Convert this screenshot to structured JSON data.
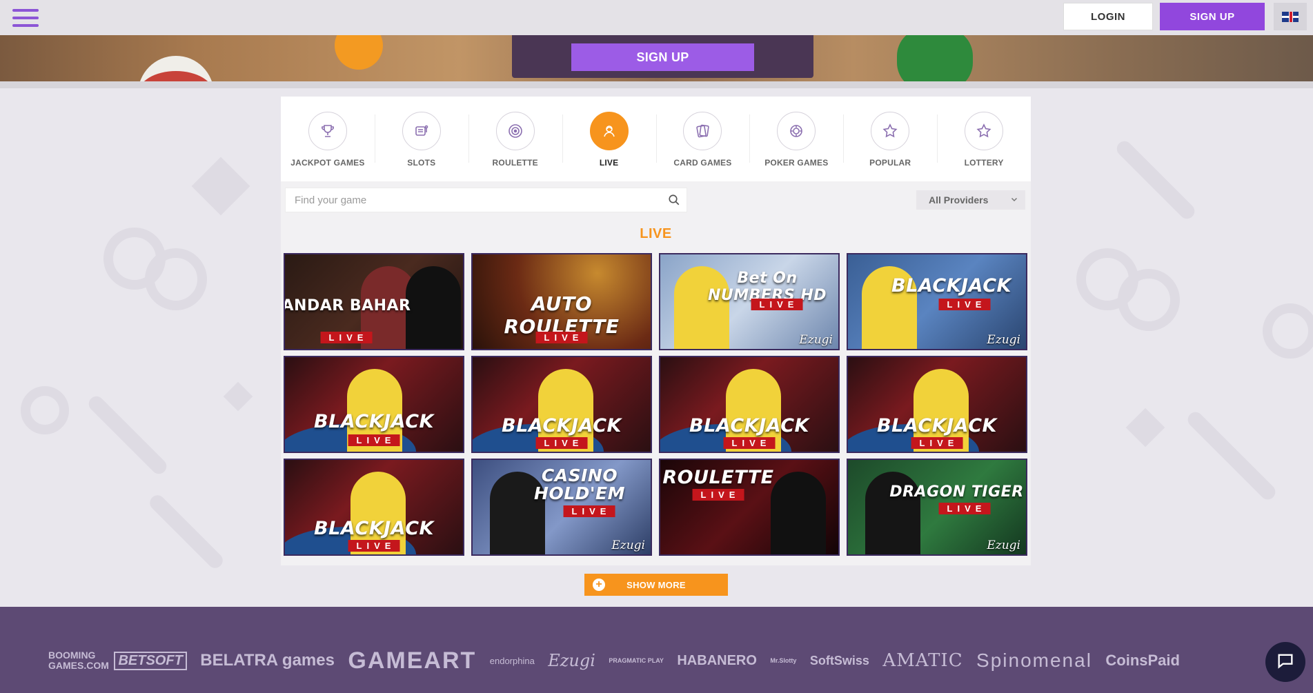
{
  "header": {
    "login_label": "LOGIN",
    "signup_label": "SIGN UP",
    "language_icon": "uk-flag-icon"
  },
  "banner": {
    "signup_label": "SIGN UP"
  },
  "categories": [
    {
      "label": "JACKPOT GAMES",
      "icon": "trophy-icon",
      "active": false
    },
    {
      "label": "SLOTS",
      "icon": "slot-machine-icon",
      "active": false
    },
    {
      "label": "ROULETTE",
      "icon": "roulette-icon",
      "active": false
    },
    {
      "label": "LIVE",
      "icon": "live-dealer-icon",
      "active": true
    },
    {
      "label": "CARD GAMES",
      "icon": "cards-icon",
      "active": false
    },
    {
      "label": "POKER GAMES",
      "icon": "poker-chip-icon",
      "active": false
    },
    {
      "label": "POPULAR",
      "icon": "star-icon",
      "active": false
    },
    {
      "label": "LOTTERY",
      "icon": "star-icon",
      "active": false
    }
  ],
  "search": {
    "placeholder": "Find your game"
  },
  "providers_filter": {
    "selected": "All Providers"
  },
  "section": {
    "title": "LIVE"
  },
  "games": [
    {
      "title": "ANDAR BAHAR",
      "badge": "LIVE",
      "brand": ""
    },
    {
      "title": "AUTO ROULETTE",
      "badge": "LIVE",
      "brand": ""
    },
    {
      "title": "Bet On NUMBERS HD",
      "badge": "LIVE",
      "brand": "Ezugi"
    },
    {
      "title": "BLACKJACK",
      "badge": "LIVE",
      "brand": "Ezugi"
    },
    {
      "title": "BLACKJACK",
      "badge": "LIVE",
      "brand": ""
    },
    {
      "title": "BLACKJACK",
      "badge": "LIVE",
      "brand": ""
    },
    {
      "title": "BLACKJACK",
      "badge": "LIVE",
      "brand": ""
    },
    {
      "title": "BLACKJACK",
      "badge": "LIVE",
      "brand": ""
    },
    {
      "title": "BLACKJACK",
      "badge": "LIVE",
      "brand": ""
    },
    {
      "title": "CASINO HOLD'EM",
      "badge": "LIVE",
      "brand": "Ezugi"
    },
    {
      "title": "ROULETTE",
      "badge": "LIVE",
      "brand": ""
    },
    {
      "title": "DRAGON TIGER",
      "badge": "LIVE",
      "brand": "Ezugi"
    }
  ],
  "show_more": {
    "label": "SHOW MORE"
  },
  "footer": {
    "provider_logos": [
      "BOOMING GAMES.COM",
      "BETSOFT",
      "BELATRA games",
      "GAMEART",
      "endorphina",
      "Ezugi",
      "PRAGMATIC PLAY",
      "HABANERO",
      "Mr.Slotty",
      "SoftSwiss",
      "AMATIC",
      "Spinomenal",
      "CoinsPaid"
    ]
  },
  "colors": {
    "brand_purple": "#9147dd",
    "accent_orange": "#f7941d",
    "footer_bg": "#5d4a74"
  }
}
